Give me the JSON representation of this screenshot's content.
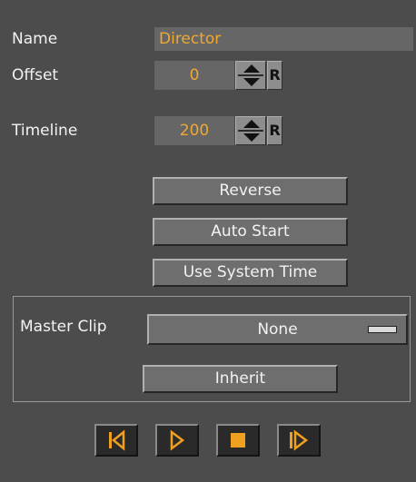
{
  "fields": {
    "name_label": "Name",
    "name_value": "Director",
    "offset_label": "Offset",
    "offset_value": "0",
    "timeline_label": "Timeline",
    "timeline_value": "200",
    "reset_label": "R"
  },
  "buttons": {
    "reverse": "Reverse",
    "auto_start": "Auto Start",
    "use_system_time": "Use System Time"
  },
  "master_clip": {
    "label": "Master Clip",
    "value": "None",
    "inherit": "Inherit"
  },
  "transport": {
    "icons": [
      "skip-to-start-icon",
      "play-icon",
      "stop-icon",
      "step-forward-icon"
    ]
  },
  "colors": {
    "panel_bg": "#4c4c4c",
    "value_text": "#f0a830",
    "icon_accent": "#f0a020"
  }
}
